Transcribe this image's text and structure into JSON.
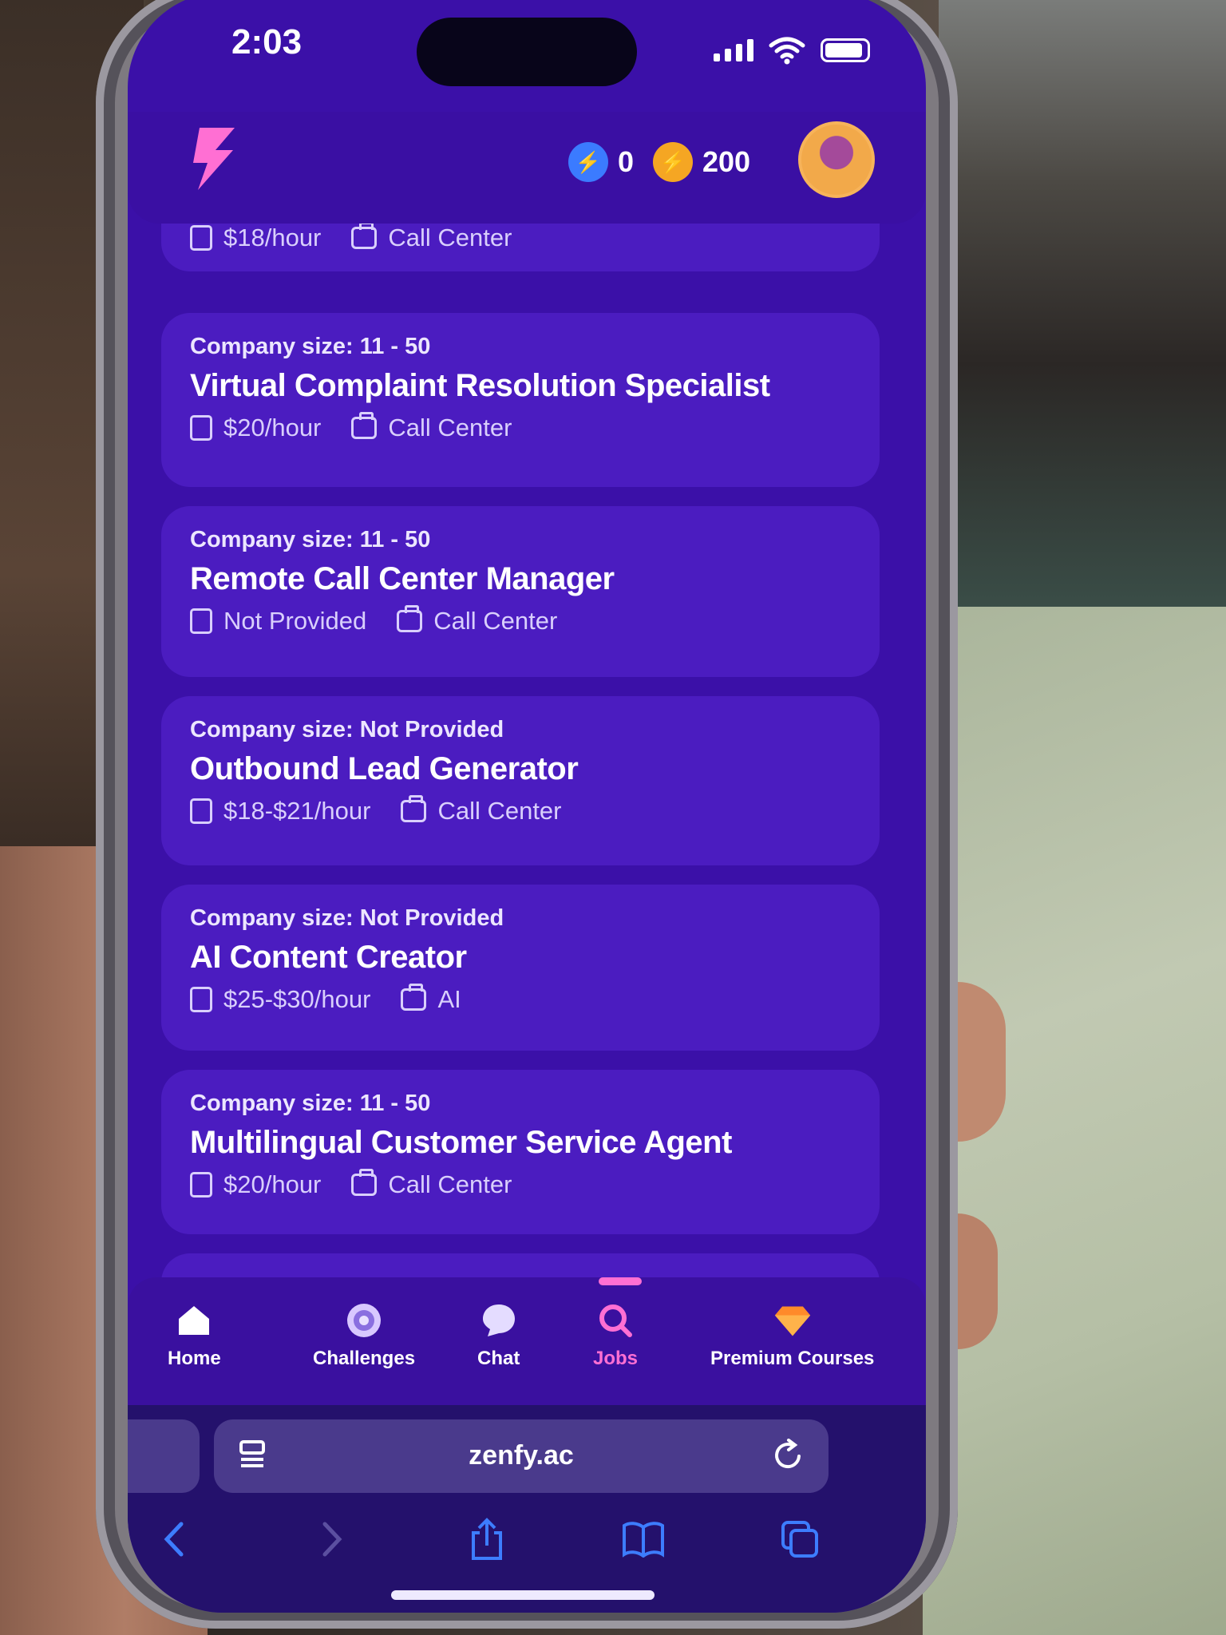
{
  "status_bar": {
    "time": "2:03"
  },
  "header": {
    "gems": "0",
    "coins": "200",
    "colors": {
      "gem": "#3b7bff",
      "coin": "#f5a623",
      "logo": "#ff6fd3"
    }
  },
  "partial_card": {
    "pay": "$18/hour",
    "category": "Call Center"
  },
  "jobs": [
    {
      "size": "Company size: 11 - 50",
      "title": "Virtual Complaint Resolution Specialist",
      "pay": "$20/hour",
      "category": "Call Center"
    },
    {
      "size": "Company size: 11 - 50",
      "title": "Remote Call Center Manager",
      "pay": "Not Provided",
      "category": "Call Center"
    },
    {
      "size": "Company size: Not Provided",
      "title": "Outbound Lead Generator",
      "pay": "$18-$21/hour",
      "category": "Call Center"
    },
    {
      "size": "Company size: Not Provided",
      "title": "AI Content Creator",
      "pay": "$25-$30/hour",
      "category": "AI"
    },
    {
      "size": "Company size: 11 - 50",
      "title": "Multilingual Customer Service Agent",
      "pay": "$20/hour",
      "category": "Call Center"
    }
  ],
  "tabbar": {
    "items": [
      {
        "label": "Home",
        "icon": "home-icon"
      },
      {
        "label": "Challenges",
        "icon": "target-icon"
      },
      {
        "label": "Chat",
        "icon": "chat-icon"
      },
      {
        "label": "Jobs",
        "icon": "search-icon",
        "active": true
      },
      {
        "label": "Premium Courses",
        "icon": "diamond-icon"
      }
    ]
  },
  "browser": {
    "url": "zenfy.ac"
  }
}
